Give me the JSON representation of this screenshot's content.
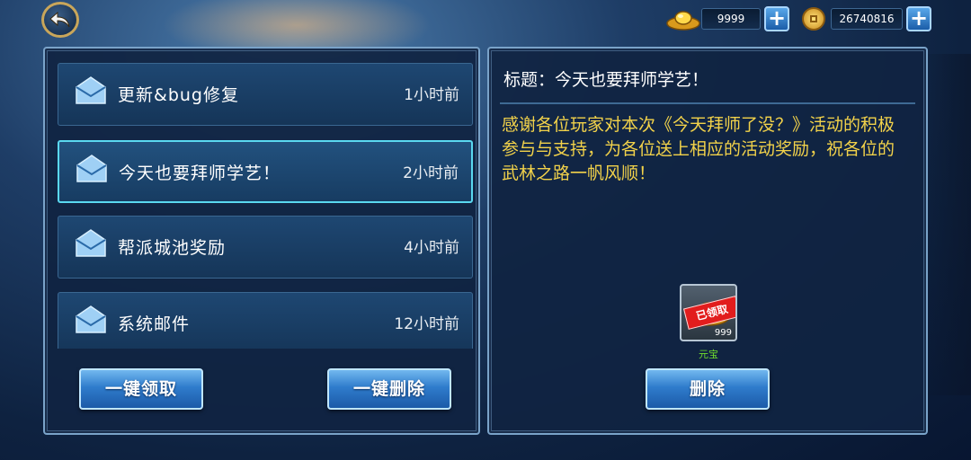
{
  "currency": {
    "gold_ingot": {
      "icon": "gold-ingot-icon",
      "amount": "9999"
    },
    "copper_coin": {
      "icon": "copper-coin-icon",
      "amount": "26740816"
    }
  },
  "mail_list": [
    {
      "icon": "envelope-icon",
      "title": "更新&bug修复",
      "time": "1小时前",
      "selected": false
    },
    {
      "icon": "envelope-icon",
      "title": "今天也要拜师学艺！",
      "time": "2小时前",
      "selected": true
    },
    {
      "icon": "envelope-icon",
      "title": "帮派城池奖励",
      "time": "4小时前",
      "selected": false
    },
    {
      "icon": "envelope-icon",
      "title": "系统邮件",
      "time": "12小时前",
      "selected": false
    }
  ],
  "buttons": {
    "claim_all": "一键领取",
    "delete_all": "一键删除",
    "delete": "删除"
  },
  "detail": {
    "title": "标题：今天也要拜师学艺！",
    "body": "感谢各位玩家对本次《今天拜师了没？》活动的积极参与与支持，为各位送上相应的活动奖励，祝各位的武林之路一帆风顺！"
  },
  "reward": {
    "icon": "gold-ingot-icon",
    "stamp": "已领取",
    "count": "999",
    "name": "元宝"
  },
  "colors": {
    "body_text": "#f2d24a",
    "selected_border": "#5ad8f0",
    "reward_name": "#6fdc2e",
    "stamp": "#e21d1d"
  }
}
